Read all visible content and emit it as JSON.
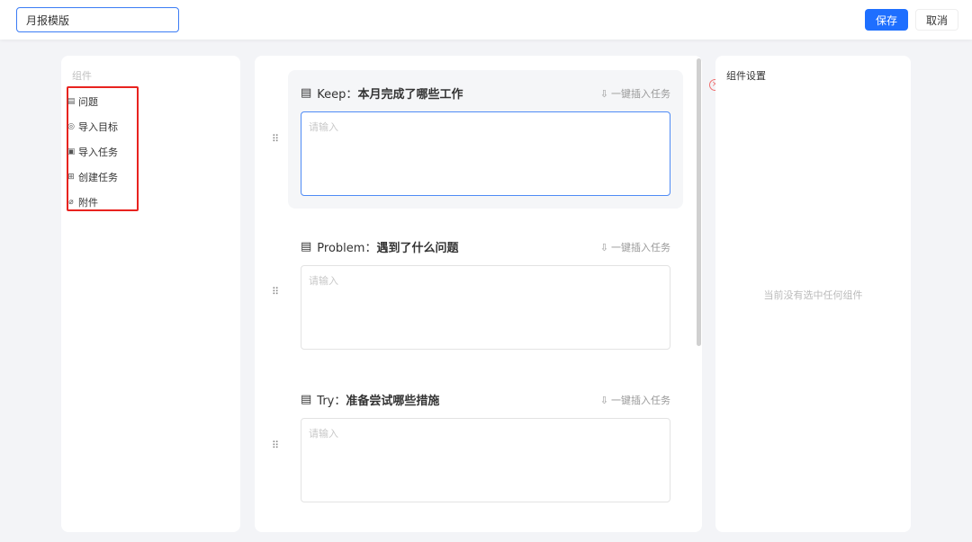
{
  "header": {
    "title_value": "月报模版",
    "save_label": "保存",
    "cancel_label": "取消"
  },
  "components": {
    "title": "组件",
    "items": [
      {
        "label": "问题",
        "icon": "document-icon"
      },
      {
        "label": "导入目标",
        "icon": "target-icon"
      },
      {
        "label": "导入任务",
        "icon": "calendar-check-icon"
      },
      {
        "label": "创建任务",
        "icon": "plus-square-icon"
      },
      {
        "label": "附件",
        "icon": "paperclip-icon"
      }
    ]
  },
  "editor": {
    "blocks": [
      {
        "title_prefix": "Keep：",
        "title": "本月完成了哪些工作",
        "insert_label": "一键插入任务",
        "placeholder": "请输入"
      },
      {
        "title_prefix": "Problem：",
        "title": "遇到了什么问题",
        "insert_label": "一键插入任务",
        "placeholder": "请输入"
      },
      {
        "title_prefix": "Try：",
        "title": "准备尝试哪些措施",
        "insert_label": "一键插入任务",
        "placeholder": "请输入"
      }
    ]
  },
  "settings": {
    "title": "组件设置",
    "empty_text": "当前没有选中任何组件"
  },
  "colors": {
    "primary": "#1e6fff",
    "highlight": "#e8231f"
  }
}
